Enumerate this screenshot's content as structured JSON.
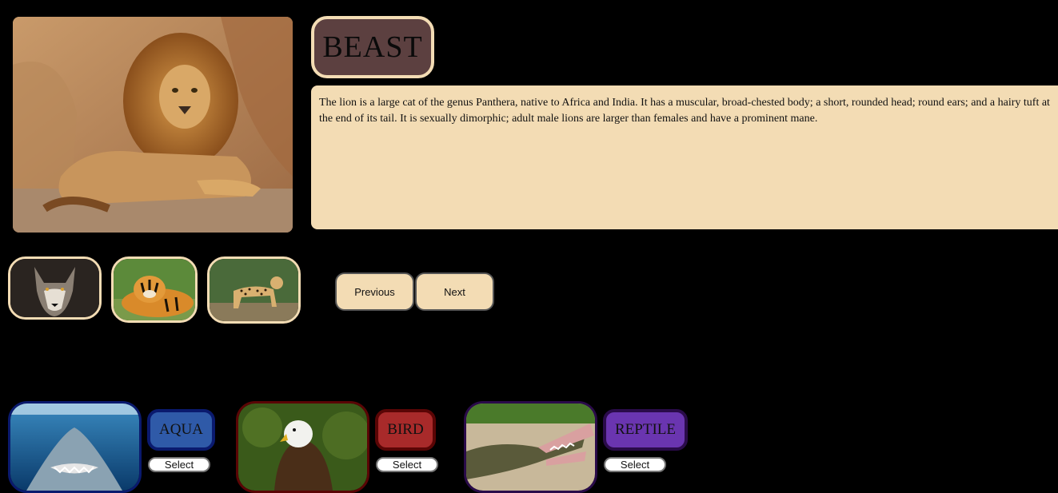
{
  "featured": {
    "title": "BEAST",
    "description": "The lion is a large cat of the genus Panthera, native to Africa and India. It has a muscular, broad-chested body; a short, rounded head; round ears; and a hairy tuft at the end of its tail. It is sexually dimorphic; adult male lions are larger than females and have a prominent mane.",
    "image_icon": "lion-image"
  },
  "thumbnails": [
    {
      "icon": "wolf-image"
    },
    {
      "icon": "tiger-image"
    },
    {
      "icon": "cheetah-image"
    }
  ],
  "nav": {
    "previous_label": "Previous",
    "next_label": "Next"
  },
  "categories": [
    {
      "label": "AQUA",
      "select_label": "Select",
      "color": "#2f5aa8",
      "border": "#0a1a6e",
      "image_icon": "shark-image"
    },
    {
      "label": "BIRD",
      "select_label": "Select",
      "color": "#a82a2a",
      "border": "#5a0505",
      "image_icon": "eagle-image"
    },
    {
      "label": "REPTILE",
      "select_label": "Select",
      "color": "#6a35b0",
      "border": "#2a0b4a",
      "image_icon": "crocodile-image"
    }
  ],
  "colors": {
    "background": "#000000",
    "accent": "#f3dcb4",
    "title_bg": "#5c4040"
  }
}
